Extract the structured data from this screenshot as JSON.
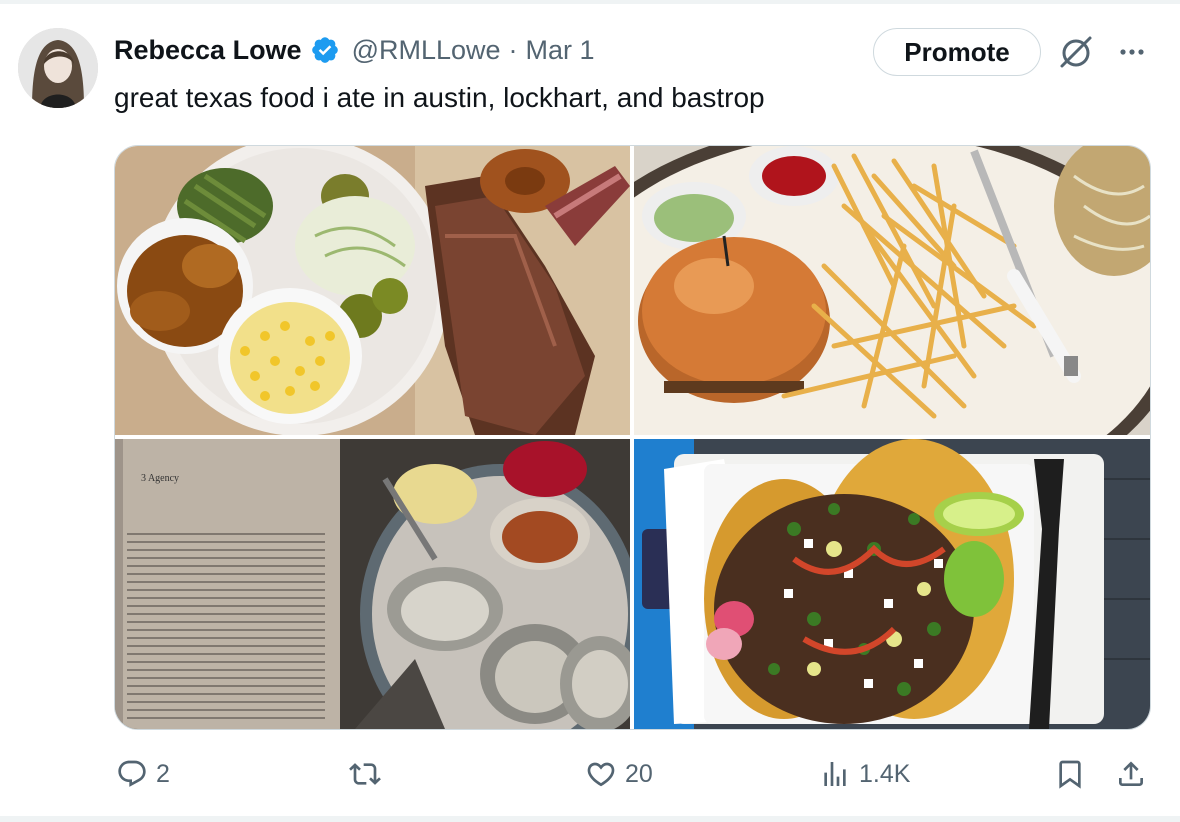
{
  "author": {
    "name": "Rebecca Lowe",
    "handle": "@RMLLowe",
    "separator": "·",
    "date": "Mar 1",
    "verified_color": "#1d9bf0"
  },
  "promote_label": "Promote",
  "tweet_text": "great texas food i ate in austin, lockhart, and bastrop",
  "media": {
    "photos": [
      {
        "description_icon": "bbq-plate-photo"
      },
      {
        "description_icon": "burger-fries-photo"
      },
      {
        "description_icon": "book-oysters-photo"
      },
      {
        "description_icon": "tacos-photo"
      }
    ],
    "book_heading": "3  Agency"
  },
  "actions": {
    "replies": "2",
    "reposts": "",
    "likes": "20",
    "views": "1.4K"
  },
  "colors": {
    "text": "#0f1419",
    "secondary": "#536471",
    "border": "#cfd9de",
    "accent": "#1d9bf0"
  }
}
